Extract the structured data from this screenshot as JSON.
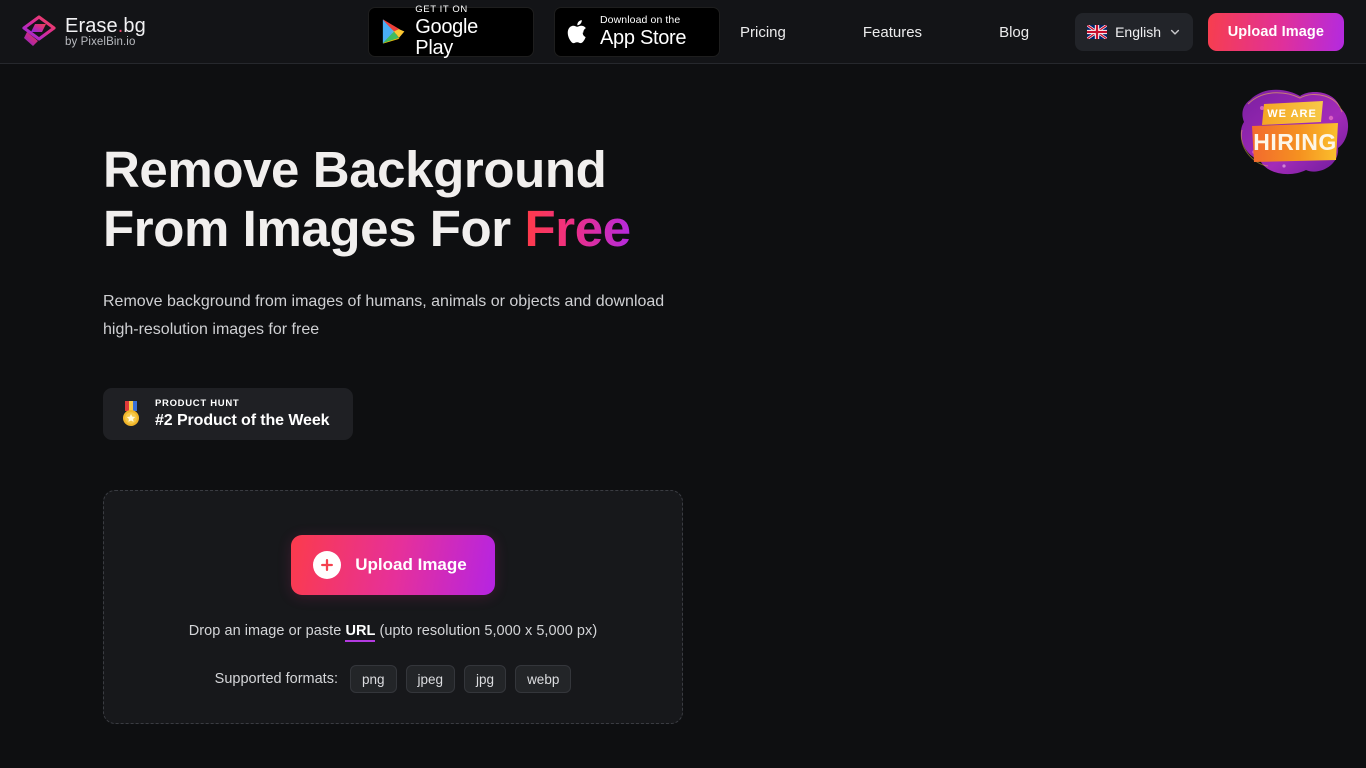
{
  "colors": {
    "page_bg": "#0e0f11",
    "header_bg": "#131417",
    "accent_red": "#fb3b4c",
    "accent_pink": "#e6309a",
    "accent_purple": "#b524e3",
    "card_bg": "#17181b",
    "chip_bg": "#232528"
  },
  "header": {
    "brand": {
      "logo_icon": "erasebg-diamond-logo",
      "title": "Erase",
      "title_dot": ".",
      "title_suffix": "bg",
      "subtitle": "by PixelBin.io"
    },
    "store_badges": [
      {
        "id": "google-play",
        "icon": "google-play-icon",
        "top": "GET IT ON",
        "bottom": "Google Play"
      },
      {
        "id": "app-store",
        "icon": "apple-icon",
        "top": "Download on the",
        "bottom": "App Store"
      }
    ],
    "nav": [
      {
        "label": "Pricing"
      },
      {
        "label": "Features"
      },
      {
        "label": "Blog"
      }
    ],
    "language": {
      "flag_icon": "uk-flag-icon",
      "label": "English",
      "chevron_icon": "chevron-down-icon"
    },
    "cta": {
      "label": "Upload Image"
    }
  },
  "hero": {
    "title_line1": "Remove Background",
    "title_line2_plain": "From Images For ",
    "title_line2_accent": "Free",
    "subtitle": "Remove background from images of humans, animals or objects and download high-resolution images for free",
    "product_hunt": {
      "icon": "medal-icon",
      "label": "PRODUCT HUNT",
      "value": "#2 Product of the Week"
    }
  },
  "hiring_badge": {
    "icon": "hiring-sticker-icon",
    "line1": "WE ARE",
    "line2": "HIRING"
  },
  "dropzone": {
    "upload_button": {
      "icon": "plus-circle-icon",
      "label": "Upload Image"
    },
    "drop_prefix": "Drop an image or paste ",
    "drop_link": "URL",
    "drop_suffix": " (upto resolution 5,000 x 5,000 px)",
    "formats_label": "Supported formats:",
    "formats": [
      "png",
      "jpeg",
      "jpg",
      "webp"
    ]
  }
}
